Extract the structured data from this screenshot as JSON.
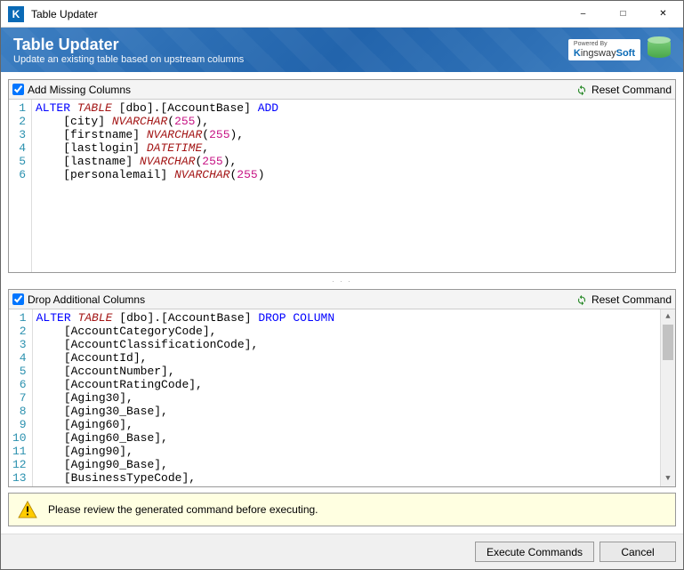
{
  "window": {
    "title": "Table Updater",
    "icon_letter": "K"
  },
  "header": {
    "title": "Table Updater",
    "subtitle": "Update an existing table based on upstream columns",
    "powered_by_label": "Powered By",
    "brand_prefix": "K",
    "brand_mid": "ingsway",
    "brand_suffix": "Soft"
  },
  "panel_add": {
    "title": "Add Missing Columns",
    "checked": true,
    "reset_label": "Reset Command",
    "lines": [
      {
        "n": 1,
        "tokens": [
          [
            "kw-blue",
            "ALTER"
          ],
          [
            "sp",
            " "
          ],
          [
            "kw-table",
            "TABLE"
          ],
          [
            "sp",
            " "
          ],
          [
            "br",
            "[dbo].[AccountBase]"
          ],
          [
            "sp",
            " "
          ],
          [
            "kw-blue",
            "ADD"
          ]
        ]
      },
      {
        "n": 2,
        "tokens": [
          [
            "sp",
            "    "
          ],
          [
            "br",
            "[city]"
          ],
          [
            "sp",
            " "
          ],
          [
            "kw-type",
            "NVARCHAR"
          ],
          [
            "br",
            "("
          ],
          [
            "kw-num",
            "255"
          ],
          [
            "br",
            "),"
          ]
        ]
      },
      {
        "n": 3,
        "tokens": [
          [
            "sp",
            "    "
          ],
          [
            "br",
            "[firstname]"
          ],
          [
            "sp",
            " "
          ],
          [
            "kw-type",
            "NVARCHAR"
          ],
          [
            "br",
            "("
          ],
          [
            "kw-num",
            "255"
          ],
          [
            "br",
            "),"
          ]
        ]
      },
      {
        "n": 4,
        "tokens": [
          [
            "sp",
            "    "
          ],
          [
            "br",
            "[lastlogin]"
          ],
          [
            "sp",
            " "
          ],
          [
            "kw-type",
            "DATETIME"
          ],
          [
            "br",
            ","
          ]
        ]
      },
      {
        "n": 5,
        "tokens": [
          [
            "sp",
            "    "
          ],
          [
            "br",
            "[lastname]"
          ],
          [
            "sp",
            " "
          ],
          [
            "kw-type",
            "NVARCHAR"
          ],
          [
            "br",
            "("
          ],
          [
            "kw-num",
            "255"
          ],
          [
            "br",
            "),"
          ]
        ]
      },
      {
        "n": 6,
        "tokens": [
          [
            "sp",
            "    "
          ],
          [
            "br",
            "[personalemail]"
          ],
          [
            "sp",
            " "
          ],
          [
            "kw-type",
            "NVARCHAR"
          ],
          [
            "br",
            "("
          ],
          [
            "kw-num",
            "255"
          ],
          [
            "br",
            ")"
          ]
        ]
      }
    ]
  },
  "panel_drop": {
    "title": "Drop Additional Columns",
    "checked": true,
    "reset_label": "Reset Command",
    "lines": [
      {
        "n": 1,
        "tokens": [
          [
            "kw-blue",
            "ALTER"
          ],
          [
            "sp",
            " "
          ],
          [
            "kw-table",
            "TABLE"
          ],
          [
            "sp",
            " "
          ],
          [
            "br",
            "[dbo].[AccountBase]"
          ],
          [
            "sp",
            " "
          ],
          [
            "kw-blue",
            "DROP"
          ],
          [
            "sp",
            " "
          ],
          [
            "kw-blue",
            "COLUMN"
          ]
        ]
      },
      {
        "n": 2,
        "tokens": [
          [
            "sp",
            "    "
          ],
          [
            "br",
            "[AccountCategoryCode],"
          ]
        ]
      },
      {
        "n": 3,
        "tokens": [
          [
            "sp",
            "    "
          ],
          [
            "br",
            "[AccountClassificationCode],"
          ]
        ]
      },
      {
        "n": 4,
        "tokens": [
          [
            "sp",
            "    "
          ],
          [
            "br",
            "[AccountId],"
          ]
        ]
      },
      {
        "n": 5,
        "tokens": [
          [
            "sp",
            "    "
          ],
          [
            "br",
            "[AccountNumber],"
          ]
        ]
      },
      {
        "n": 6,
        "tokens": [
          [
            "sp",
            "    "
          ],
          [
            "br",
            "[AccountRatingCode],"
          ]
        ]
      },
      {
        "n": 7,
        "tokens": [
          [
            "sp",
            "    "
          ],
          [
            "br",
            "[Aging30],"
          ]
        ]
      },
      {
        "n": 8,
        "tokens": [
          [
            "sp",
            "    "
          ],
          [
            "br",
            "[Aging30_Base],"
          ]
        ]
      },
      {
        "n": 9,
        "tokens": [
          [
            "sp",
            "    "
          ],
          [
            "br",
            "[Aging60],"
          ]
        ]
      },
      {
        "n": 10,
        "tokens": [
          [
            "sp",
            "    "
          ],
          [
            "br",
            "[Aging60_Base],"
          ]
        ]
      },
      {
        "n": 11,
        "tokens": [
          [
            "sp",
            "    "
          ],
          [
            "br",
            "[Aging90],"
          ]
        ]
      },
      {
        "n": 12,
        "tokens": [
          [
            "sp",
            "    "
          ],
          [
            "br",
            "[Aging90_Base],"
          ]
        ]
      },
      {
        "n": 13,
        "tokens": [
          [
            "sp",
            "    "
          ],
          [
            "br",
            "[BusinessTypeCode],"
          ]
        ]
      }
    ]
  },
  "warning": {
    "text": "Please review the generated command before executing."
  },
  "footer": {
    "execute": "Execute Commands",
    "cancel": "Cancel"
  }
}
